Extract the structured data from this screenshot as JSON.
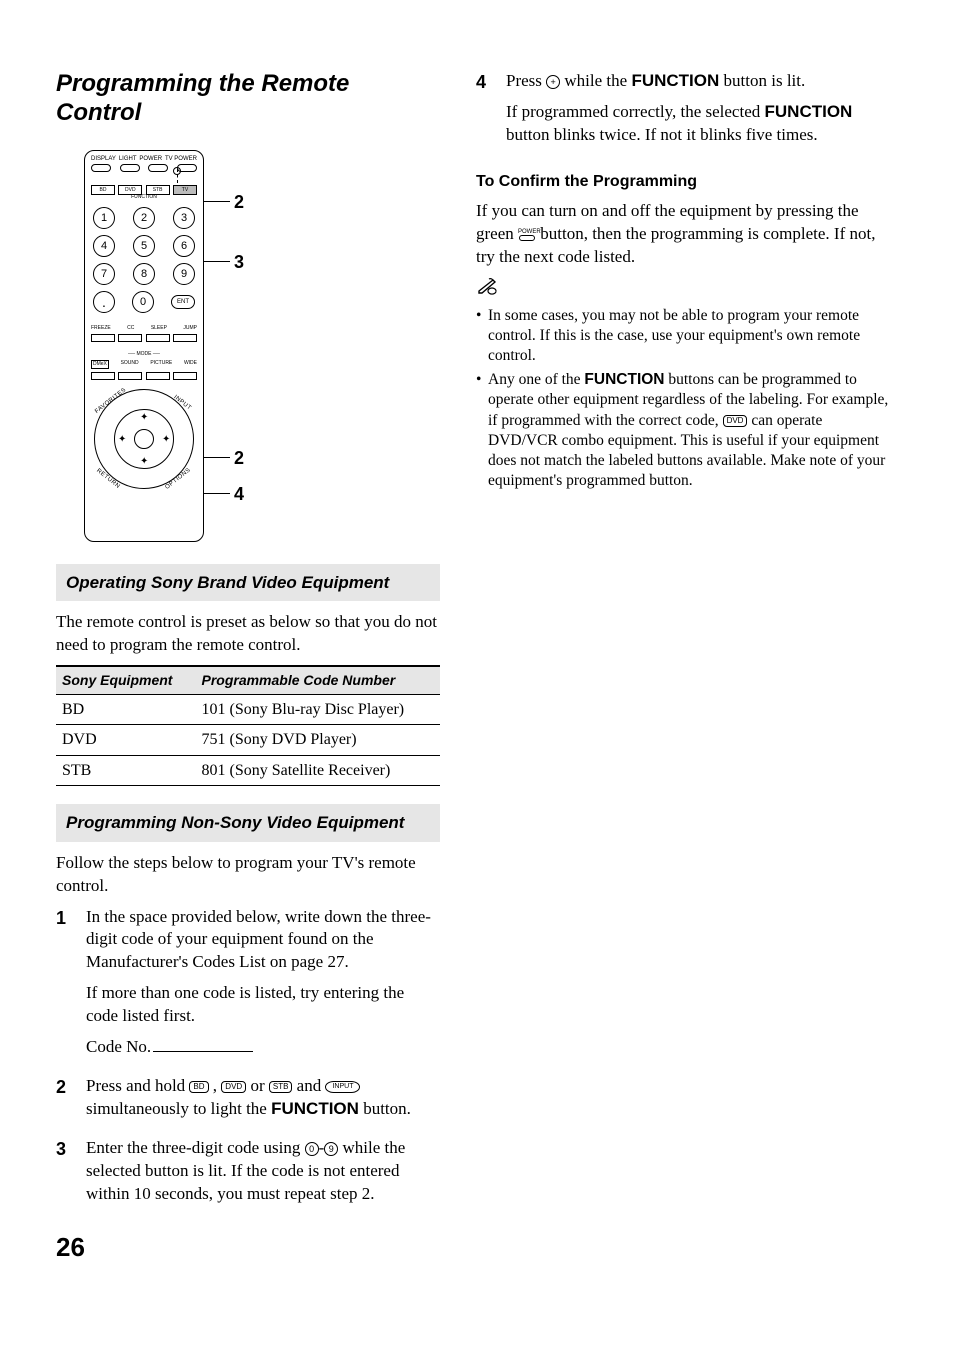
{
  "main_title": "Programming the Remote Control",
  "diagram": {
    "top_labels": [
      "DISPLAY",
      "LIGHT",
      "POWER",
      "TV POWER"
    ],
    "fn_buttons": [
      "BD",
      "DVD",
      "STB",
      "TV"
    ],
    "fn_label": "FUNCTION",
    "numpad": [
      "1",
      "2",
      "3",
      "4",
      "5",
      "6",
      "7",
      "8",
      "9"
    ],
    "bottom_row": [
      ".",
      "0",
      "ENT"
    ],
    "small_labels": [
      "FREEZE",
      "CC",
      "SLEEP",
      "JUMP"
    ],
    "mode_labels": [
      "DMeX",
      "SOUND",
      "PICTURE",
      "WIDE"
    ],
    "mode_word": "MODE",
    "ring_labels": {
      "fav": "FAVORITES",
      "input": "INPUT",
      "ret": "RETURN",
      "opt": "OPTIONS"
    },
    "callouts": {
      "a": "2",
      "b": "3",
      "c": "2",
      "d": "4"
    }
  },
  "section1": {
    "title": "Operating Sony Brand Video Equipment",
    "intro": "The remote control is preset as below so that you do not need to program the remote control.",
    "table": {
      "head": [
        "Sony Equipment",
        "Programmable Code Number"
      ],
      "rows": [
        [
          "BD",
          "101 (Sony Blu-ray Disc Player)"
        ],
        [
          "DVD",
          "751 (Sony DVD Player)"
        ],
        [
          "STB",
          "801 (Sony Satellite Receiver)"
        ]
      ]
    }
  },
  "section2": {
    "title": "Programming Non-Sony Video Equipment",
    "intro": "Follow the steps below to program your TV's remote control.",
    "steps": {
      "s1_a": "In the space provided below, write down the three-digit code of your equipment found on the Manufacturer's Codes List on page 27.",
      "s1_b": "If more than one code is listed, try entering the code listed first.",
      "s1_c": "Code No.",
      "s2_a": "Press and hold ",
      "s2_sep": " , ",
      "s2_or": " or ",
      "s2_and": " and ",
      "s2_b": " simultaneously to light the ",
      "s2_fn": "FUNCTION",
      "s2_c": " button.",
      "s3_a": "Enter the three-digit code using ",
      "s3_dash": "-",
      "s3_b": " while the selected button is lit. If the code is not entered within 10 seconds, you must repeat step 2."
    },
    "pills": {
      "bd": "BD",
      "dvd": "DVD",
      "stb": "STB",
      "input": "INPUT",
      "zero": "0",
      "nine": "9",
      "plus": "+"
    }
  },
  "page_number": "26",
  "right": {
    "step4": {
      "num": "4",
      "a": "Press ",
      "b": " while the ",
      "fn": "FUNCTION",
      "c": " button is lit.",
      "d": "If programmed correctly, the selected ",
      "e": " button blinks twice. If not it blinks five times."
    },
    "confirm": {
      "title": "To Confirm the Programming",
      "a": "If you can turn on and off the equipment by pressing the green ",
      "b": " button, then the programming is complete. If not, try the next code listed.",
      "power": "POWER"
    },
    "notes": {
      "n1": "In some cases, you may not be able to program your remote control. If this is the case, use your equipment's own remote control.",
      "n2_a": "Any one of the ",
      "n2_fn": "FUNCTION",
      "n2_b": " buttons can be programmed to operate other equipment regardless of the labeling. For example, if programmed with the correct code, ",
      "n2_c": " can operate DVD/VCR combo equipment. This is useful if your equipment does not match the labeled buttons available. Make note of your equipment's programmed button.",
      "dvd": "DVD"
    }
  }
}
